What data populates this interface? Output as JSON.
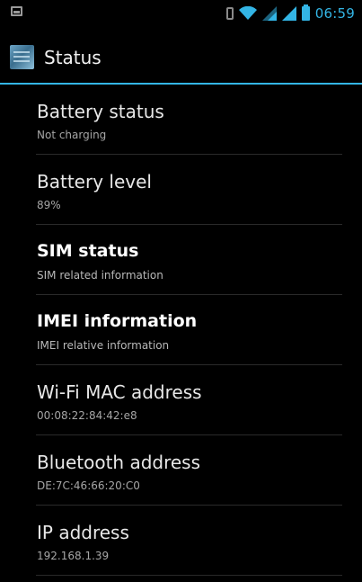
{
  "status_bar": {
    "time": "06:59",
    "icons": [
      "screenshot-icon",
      "vibrate-icon",
      "wifi-icon",
      "signal-icon",
      "signal-icon",
      "battery-icon"
    ],
    "accent_color": "#33b5e5"
  },
  "action_bar": {
    "title": "Status",
    "icon": "settings-app-icon"
  },
  "items": [
    {
      "title": "Battery status",
      "subtitle": "Not charging"
    },
    {
      "title": "Battery level",
      "subtitle": "89%"
    },
    {
      "title": "SIM status",
      "subtitle": "SIM related information"
    },
    {
      "title": "IMEI information",
      "subtitle": "IMEI relative information"
    },
    {
      "title": "Wi-Fi MAC address",
      "subtitle": "00:08:22:84:42:e8"
    },
    {
      "title": "Bluetooth address",
      "subtitle": "DE:7C:46:66:20:C0"
    },
    {
      "title": "IP address",
      "subtitle": "192.168.1.39"
    }
  ]
}
